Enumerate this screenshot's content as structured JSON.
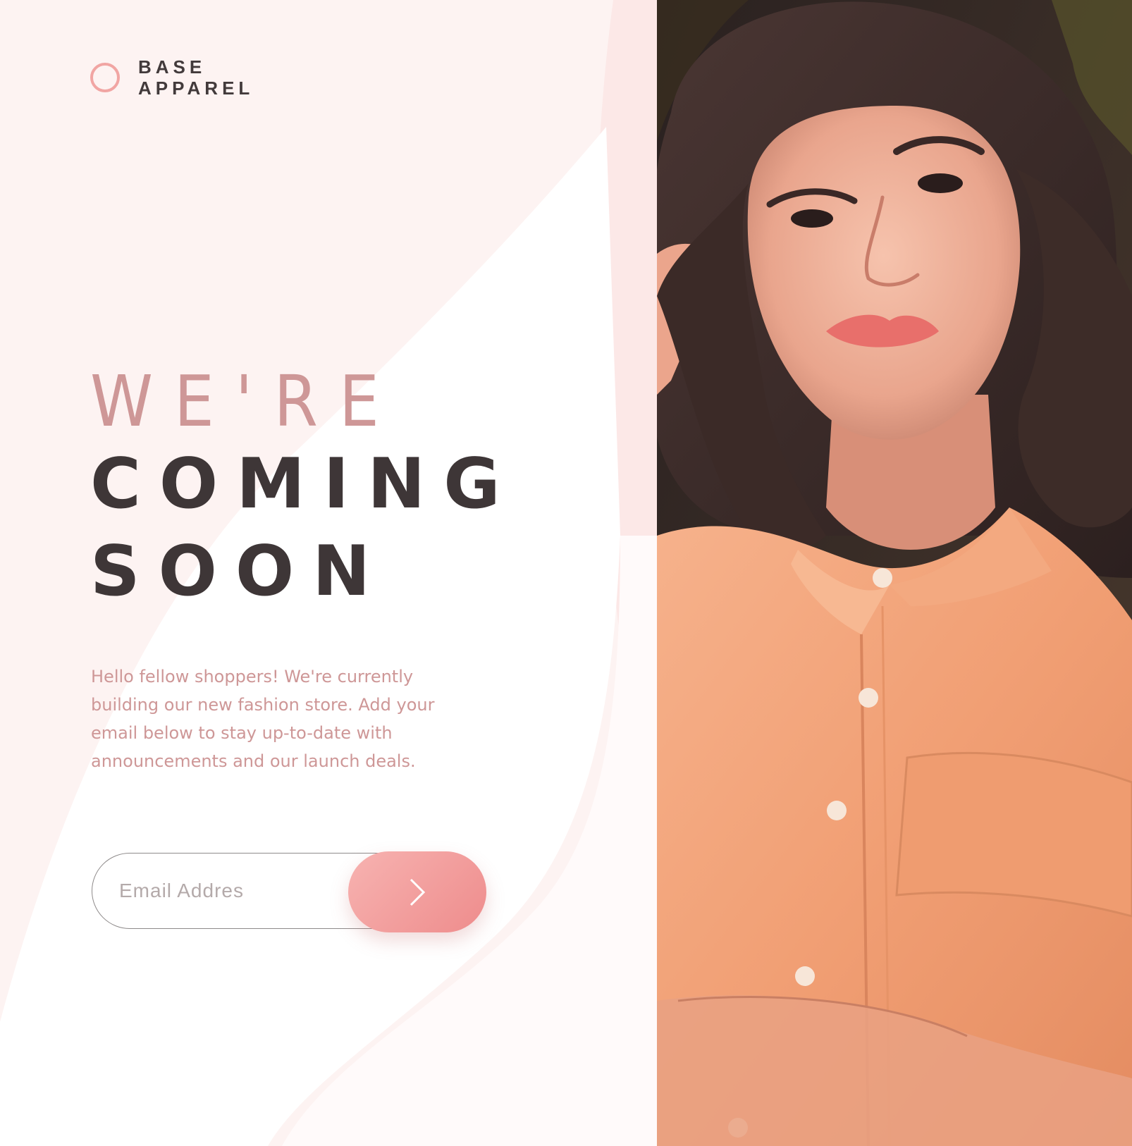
{
  "brand": {
    "line1": "BASE",
    "line2": "APPAREL",
    "logo_icon": "ring-icon",
    "accent_color": "#f1a5a3"
  },
  "hero": {
    "headline_light": "WE'RE",
    "headline_bold_line1": "COMING",
    "headline_bold_line2": "SOON",
    "light_color": "#ce9797",
    "dark_color": "#3e3637"
  },
  "description": "Hello fellow shoppers! We're currently building our new fashion store. Add your email below to stay up-to-date with announcements and our launch deals.",
  "email_form": {
    "placeholder": "Email Addres",
    "value": "",
    "submit_icon": "chevron-right-icon",
    "button_gradient": [
      "#f7b3b1",
      "#ee8c8c"
    ]
  },
  "hero_image": {
    "icon": "woman-portrait-photo",
    "shirt_color": "#f2a57c",
    "hair_color": "#3a2b29"
  }
}
